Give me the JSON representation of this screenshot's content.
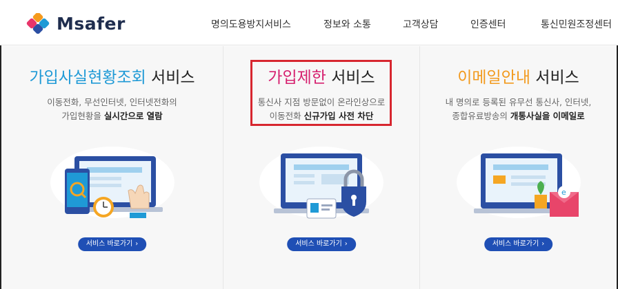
{
  "header": {
    "logo_text": "Msafer",
    "nav": [
      "명의도용방지서비스",
      "정보와 소통",
      "고객상담",
      "인증센터",
      "통신민원조정센터"
    ]
  },
  "services": [
    {
      "title_highlight": "가입사실현황조회",
      "title_rest": " 서비스",
      "highlight_color": "#1f9ad6",
      "desc_line1": "이동전화, 무선인터넷, 인터넷전화의",
      "desc_line2_plain": "가입현황을 ",
      "desc_line2_bold": "실시간으로 열람",
      "button": "서비스 바로가기"
    },
    {
      "title_highlight": "가입제한",
      "title_rest": " 서비스",
      "highlight_color": "#d6206f",
      "desc_line1": "통신사 지점 방문없이 온라인상으로",
      "desc_line2_plain": "이동전화 ",
      "desc_line2_bold": "신규가입 사전 차단",
      "button": "서비스 바로가기"
    },
    {
      "title_highlight": "이메일안내",
      "title_rest": " 서비스",
      "highlight_color": "#f29a1e",
      "desc_line1": "내 명의로 등록된 유무선 통신사, 인터넷,",
      "desc_line2_plain": "종합유료방송의 ",
      "desc_line2_bold": "개통사실을 이메일로",
      "button": "서비스 바로가기"
    }
  ],
  "colors": {
    "button_bg": "#1f4fb5",
    "highlight_border": "#d7262f"
  }
}
